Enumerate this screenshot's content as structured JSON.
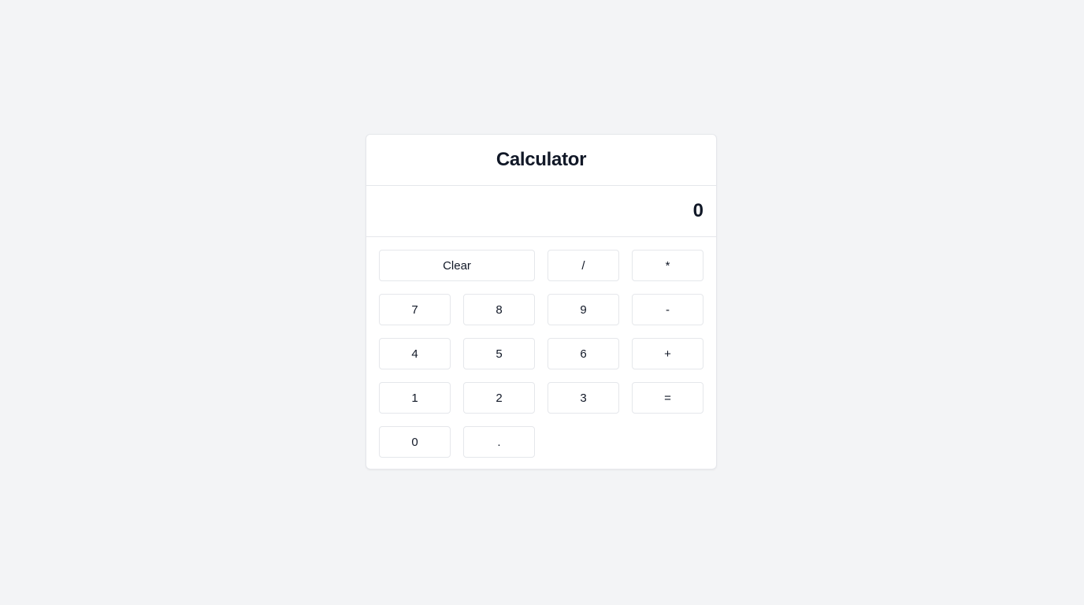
{
  "header": {
    "title": "Calculator"
  },
  "display": {
    "value": "0"
  },
  "keys": {
    "clear": "Clear",
    "divide": "/",
    "multiply": "*",
    "seven": "7",
    "eight": "8",
    "nine": "9",
    "subtract": "-",
    "four": "4",
    "five": "5",
    "six": "6",
    "add": "+",
    "one": "1",
    "two": "2",
    "three": "3",
    "equals": "=",
    "zero": "0",
    "decimal": "."
  },
  "colors": {
    "page_background": "#f3f4f6",
    "card_background": "#ffffff",
    "border": "#e5e7eb",
    "text": "#111827"
  }
}
